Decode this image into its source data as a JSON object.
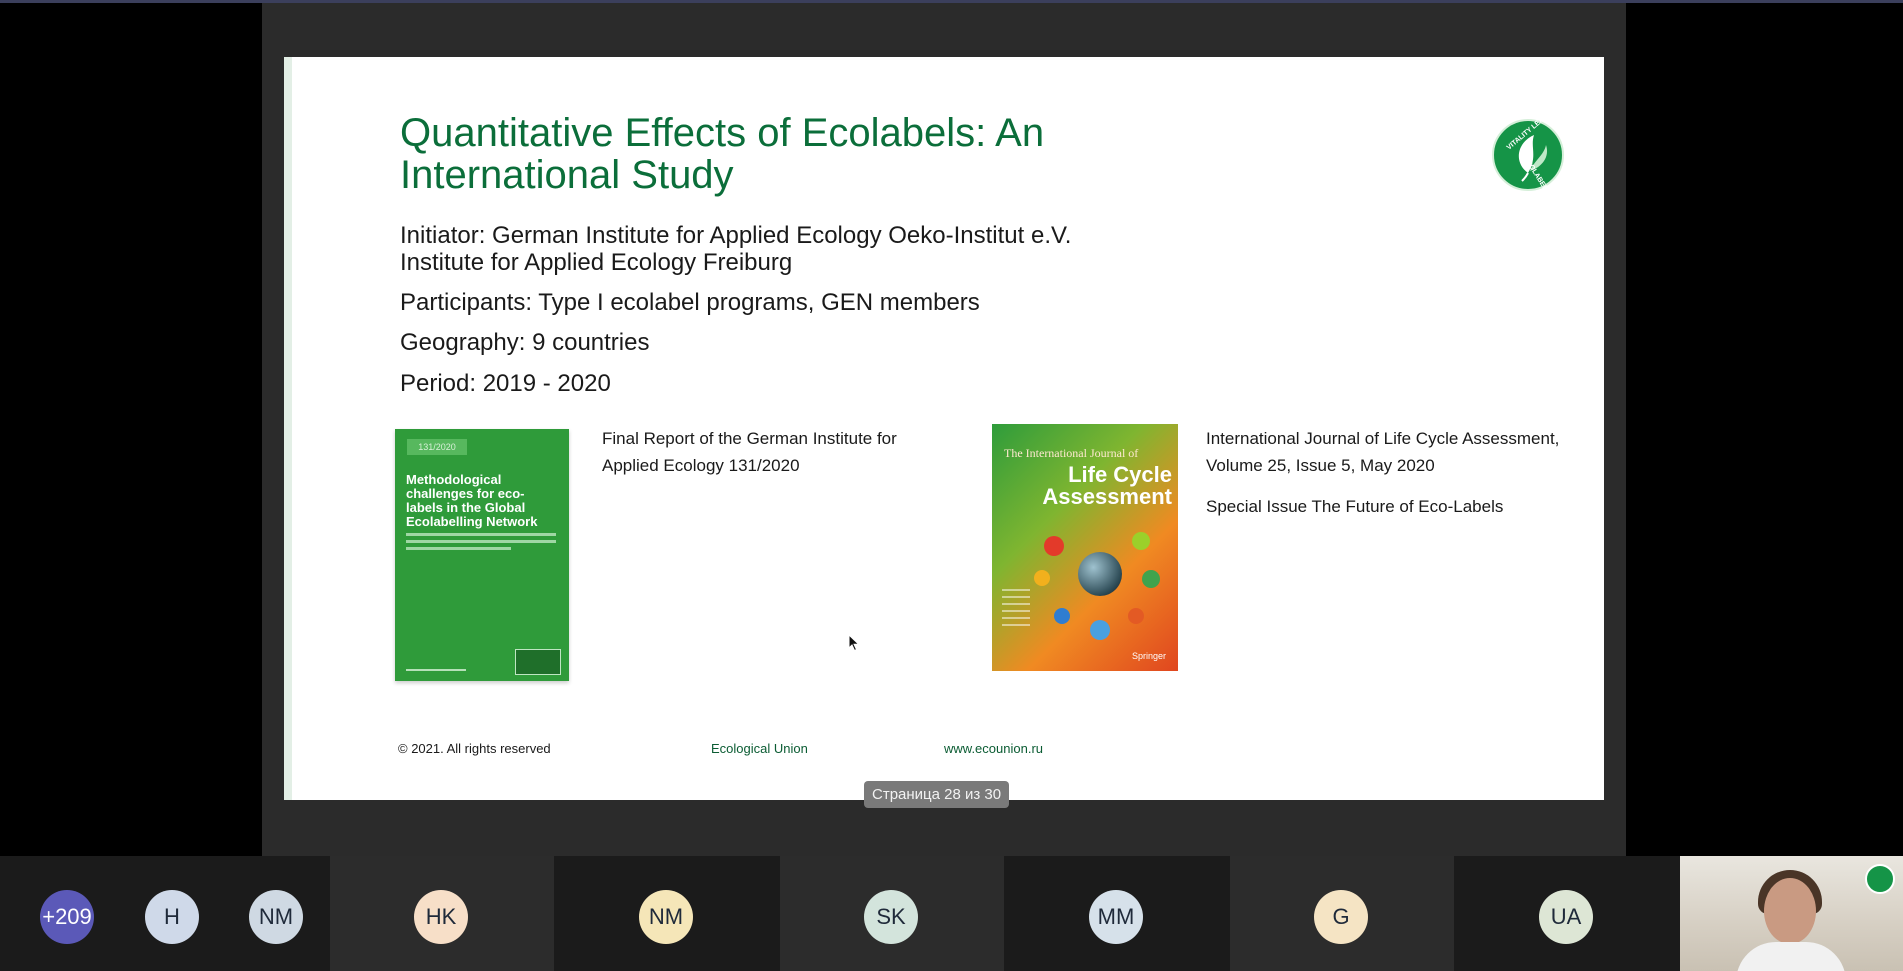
{
  "slide": {
    "title": "Quantitative Effects of Ecolabels: An International Study",
    "initiator": "Initiator: German Institute for Applied Ecology Oeko-Institut e.V. Institute for Applied Ecology Freiburg",
    "participants": "Participants: Type I ecolabel programs, GEN members",
    "geography": "Geography: 9 countries",
    "period": "Period: 2019 - 2020",
    "logo_top_text": "VITALITY LEAF",
    "logo_bottom_text": "ECOLABELS",
    "book1": {
      "cover_number": "131/2020",
      "cover_title": "Methodological challenges for eco-labels in the Global Ecolabelling Network",
      "caption": "Final Report of the German Institute for Applied Ecology 131/2020"
    },
    "book2": {
      "cover_pre": "The International Journal of",
      "cover_title": "Life Cycle Assessment",
      "caption": "International Journal of Life Cycle Assessment, Volume 25, Issue 5, May 2020",
      "special": "Special Issue The Future of Eco-Labels"
    },
    "footer": {
      "copyright": "© 2021. All rights reserved",
      "org": "Ecological Union",
      "website": "www.ecounion.ru"
    }
  },
  "page_indicator": "Страница 28 из 30",
  "participants_bar": [
    {
      "initials": "+209",
      "color": "#5b59b8",
      "text_color": "#ffffff"
    },
    {
      "initials": "H",
      "color": "#cfd9e9",
      "text_color": "#1f2a3a"
    },
    {
      "initials": "NM",
      "color": "#cfd9e3",
      "text_color": "#1f2a3a"
    },
    {
      "initials": "HK",
      "color": "#f7dfc8",
      "text_color": "#1f2a3a"
    },
    {
      "initials": "NM",
      "color": "#f5e6b8",
      "text_color": "#1f2a3a"
    },
    {
      "initials": "SK",
      "color": "#d3e4dc",
      "text_color": "#1f2a3a"
    },
    {
      "initials": "MM",
      "color": "#d6e1ea",
      "text_color": "#1f2a3a"
    },
    {
      "initials": "G",
      "color": "#f5e4c4",
      "text_color": "#1f2a3a"
    },
    {
      "initials": "UA",
      "color": "#dde6d5",
      "text_color": "#1f2a3a"
    }
  ],
  "colors": {
    "title_green": "#0b6e3a",
    "brand_green": "#159447"
  }
}
